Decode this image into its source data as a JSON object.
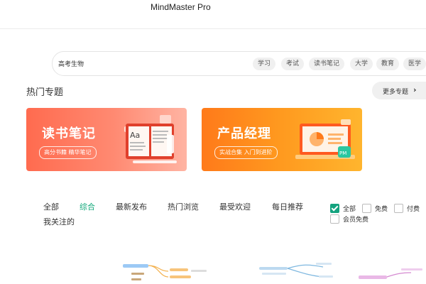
{
  "window": {
    "title": "MindMaster Pro"
  },
  "search": {
    "query": "高考生物",
    "tags": [
      "学习",
      "考试",
      "读书笔记",
      "大学",
      "教育",
      "医学"
    ]
  },
  "hot_topics": {
    "title": "热门专题",
    "more_label": "更多专题",
    "banners": [
      {
        "title": "读书笔记",
        "subtitle": "高分书籍 精华笔记",
        "color": "#ff6b4f"
      },
      {
        "title": "产品经理",
        "subtitle": "实战合集 入门到进阶",
        "color": "#ff8a1f"
      }
    ]
  },
  "filters": {
    "tabs": [
      "全部",
      "综合",
      "最新发布",
      "热门浏览",
      "最受欢迎",
      "每日推荐",
      "我关注的"
    ],
    "active_tab": "综合",
    "price_options": [
      {
        "label": "全部",
        "checked": true
      },
      {
        "label": "免费",
        "checked": false
      },
      {
        "label": "付费",
        "checked": false
      },
      {
        "label": "会员免费",
        "checked": false
      }
    ]
  },
  "colors": {
    "accent": "#12a87a"
  }
}
